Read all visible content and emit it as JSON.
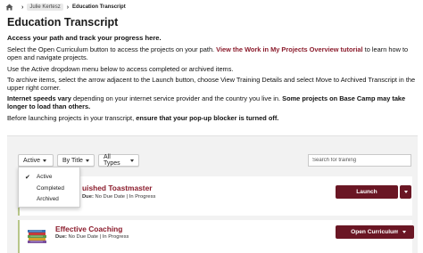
{
  "breadcrumb": {
    "home": "home-icon",
    "user": "Julie Kertesz",
    "current": "Education Transcript"
  },
  "page": {
    "title": "Education Transcript"
  },
  "intro": {
    "lead": "Access your path and track your progress here.",
    "p2_a": "Select the Open Curriculum button to access the projects on your path.",
    "p2_link": "View the Work in My Projects Overview tutorial",
    "p2_b": "to learn how to open and navigate projects.",
    "p3": "Use the Active dropdown menu below to access completed or archived items.",
    "p4": "To archive items, select the arrow adjacent to the Launch button, choose View Training Details and select Move to Archived Transcript in the upper right corner.",
    "p5_a": "Internet speeds vary",
    "p5_b": "depending on your internet service provider and the country you live in.",
    "p5_c": "Some projects on Base Camp may take longer to load than others.",
    "p6_a": "Before launching projects in your transcript,",
    "p6_b": "ensure that your pop-up blocker is turned off."
  },
  "filters": {
    "status": "Active",
    "sort": "By Title",
    "types": "All Types",
    "search_placeholder": "Search for training"
  },
  "status_menu": {
    "options": [
      "Active",
      "Completed",
      "Archived"
    ],
    "selected": "Active"
  },
  "items": [
    {
      "title_partial": "uished Toastmaster",
      "due_label": "Due:",
      "due": "No Due Date",
      "status": "In Progress",
      "action": "Launch"
    },
    {
      "title": "Effective Coaching",
      "due_label": "Due:",
      "due": "No Due Date",
      "status": "In Progress",
      "action": "Open Curriculum"
    }
  ],
  "colors": {
    "accent": "#8b1c2c",
    "button": "#6a1624",
    "card_border": "#b8c68a"
  }
}
